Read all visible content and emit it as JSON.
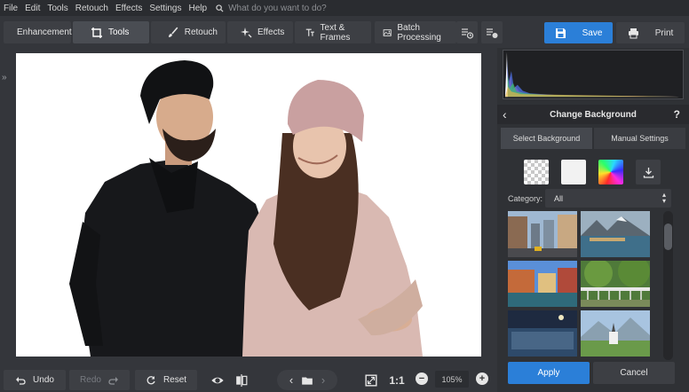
{
  "menu": [
    "File",
    "Edit",
    "Tools",
    "Retouch",
    "Effects",
    "Settings",
    "Help"
  ],
  "search": {
    "placeholder": "What do you want to do?"
  },
  "toolbar": {
    "tabs": [
      {
        "label": "Enhancement",
        "icon": "sliders-icon"
      },
      {
        "label": "Tools",
        "icon": "crop-icon"
      },
      {
        "label": "Retouch",
        "icon": "brush-icon"
      },
      {
        "label": "Effects",
        "icon": "sparkle-icon"
      },
      {
        "label": "Text & Frames",
        "icon": "text-icon"
      },
      {
        "label": "Batch Processing",
        "icon": "images-icon"
      }
    ],
    "active_tab": "Tools",
    "save_label": "Save",
    "print_label": "Print"
  },
  "bottom_bar": {
    "undo_label": "Undo",
    "redo_label": "Redo",
    "reset_label": "Reset",
    "actual_size_label": "1:1",
    "zoom": "105%"
  },
  "panel": {
    "title": "Change Background",
    "help": "?",
    "tabs": [
      "Select Background",
      "Manual Settings"
    ],
    "active_tab": "Select Background",
    "category_label": "Category:",
    "category_value": "All",
    "thumbnails": [
      "city-street",
      "lake-mountains",
      "canal-town",
      "park-bridge",
      "night-city",
      "mountain-church"
    ],
    "apply_label": "Apply",
    "cancel_label": "Cancel"
  },
  "colors": {
    "accent": "#2b7fd8",
    "panel_bg": "#2f3135",
    "toolbar_bg": "#34363b"
  }
}
